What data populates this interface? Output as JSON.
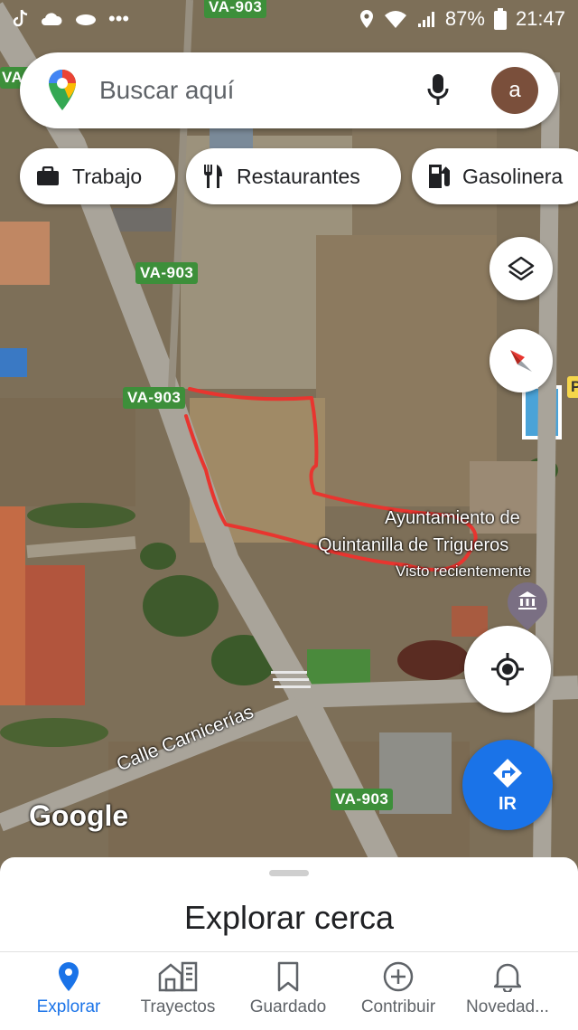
{
  "status_bar": {
    "dots": "•••",
    "battery": "87%",
    "time": "21:47"
  },
  "search": {
    "placeholder": "Buscar aquí",
    "avatar_letter": "a"
  },
  "chips": [
    {
      "label": "Trabajo",
      "icon": "briefcase-icon"
    },
    {
      "label": "Restaurantes",
      "icon": "fork-knife-icon"
    },
    {
      "label": "Gasolinera",
      "icon": "gas-station-icon"
    }
  ],
  "map": {
    "road_labels": [
      "VA-903",
      "VA-903",
      "VA-903",
      "VA-903",
      "VA-"
    ],
    "poi_name_line1": "Ayuntamiento de",
    "poi_name_line2": "Quintanilla de Trigueros",
    "poi_subtitle": "Visto recientemente",
    "street_label": "Calle Carnicerías",
    "partial_label": "P",
    "attribution": "Google"
  },
  "controls": {
    "layers_icon": "layers-icon",
    "compass_icon": "compass-icon",
    "my_location_icon": "my-location-icon",
    "go_label": "IR"
  },
  "sheet": {
    "title": "Explorar cerca"
  },
  "bottom_nav": [
    {
      "label": "Explorar",
      "icon": "location-pin-icon",
      "active": true
    },
    {
      "label": "Trayectos",
      "icon": "commute-icon",
      "active": false
    },
    {
      "label": "Guardado",
      "icon": "bookmark-icon",
      "active": false
    },
    {
      "label": "Contribuir",
      "icon": "add-circle-icon",
      "active": false
    },
    {
      "label": "Novedad...",
      "icon": "bell-icon",
      "active": false
    }
  ],
  "colors": {
    "accent": "#1a73e8",
    "road_label_bg": "#3d8f3a",
    "annotation": "#e8352f"
  }
}
